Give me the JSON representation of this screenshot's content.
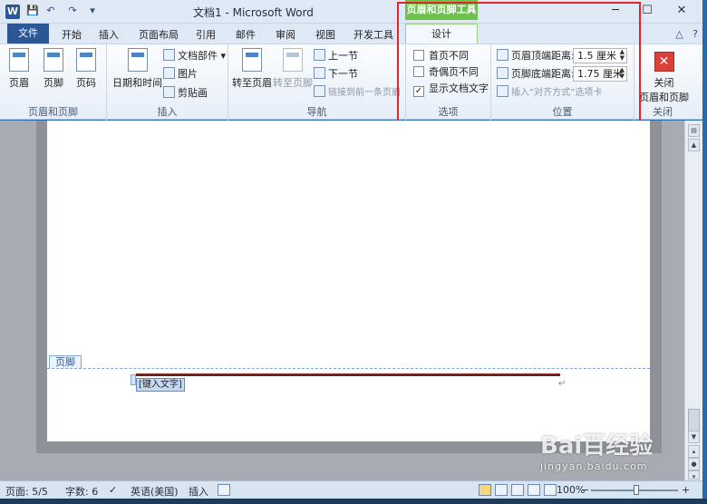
{
  "window": {
    "title": "文档1 - Microsoft Word",
    "app_icon_letter": "W",
    "contextual_tools_label": "页眉和页脚工具",
    "minimize": "─",
    "maximize": "☐",
    "close": "✕"
  },
  "quick_access": {
    "save": "💾",
    "undo": "↶",
    "redo": "↷",
    "customize": "▾"
  },
  "tabs": [
    "文件",
    "开始",
    "插入",
    "页面布局",
    "引用",
    "邮件",
    "审阅",
    "视图",
    "开发工具",
    "设计"
  ],
  "help": {
    "minimize_ribbon": "△",
    "help": "?"
  },
  "ribbon": {
    "group_header_footer": {
      "label": "页眉和页脚",
      "header": "页眉",
      "footer": "页脚",
      "page_number": "页码"
    },
    "group_insert": {
      "label": "插入",
      "date_time": "日期和时间",
      "doc_parts": "文档部件 ▾",
      "picture": "图片",
      "clip_art": "剪贴画"
    },
    "group_navigation": {
      "label": "导航",
      "goto_header": "转至页眉",
      "goto_footer": "转至页脚",
      "prev_section": "上一节",
      "next_section": "下一节",
      "link_previous": "链接到前一条页眉"
    },
    "group_options": {
      "label": "选项",
      "different_first": "首页不同",
      "different_odd_even": "奇偶页不同",
      "show_doc_text": "显示文档文字",
      "checked_mark": "✓"
    },
    "group_position": {
      "label": "位置",
      "header_top_label": "页眉顶端距离:",
      "header_top_value": "1.5 厘米",
      "footer_bottom_label": "页脚底端距离:",
      "footer_bottom_value": "1.75 厘米",
      "insert_align_tab": "插入“对齐方式”选项卡"
    },
    "group_close": {
      "label": "关闭",
      "close_line1": "关闭",
      "close_line2": "页眉和页脚",
      "close_icon": "✕"
    }
  },
  "document": {
    "footer_tag": "页脚",
    "placeholder": "[键入文字]",
    "paragraph_mark": "↵"
  },
  "statusbar": {
    "page": "页面: 5/5",
    "words": "字数: 6",
    "language": "英语(美国)",
    "mode": "插入",
    "zoom": "100%",
    "zoom_minus": "−",
    "zoom_plus": "+"
  },
  "watermark": {
    "logo": "Bai百经验",
    "url": "jingyan.baidu.com"
  },
  "colors": {
    "file_tab": "#2b5797",
    "contextual_green": "#6cc24a",
    "highlight_box": "#e0252b"
  }
}
